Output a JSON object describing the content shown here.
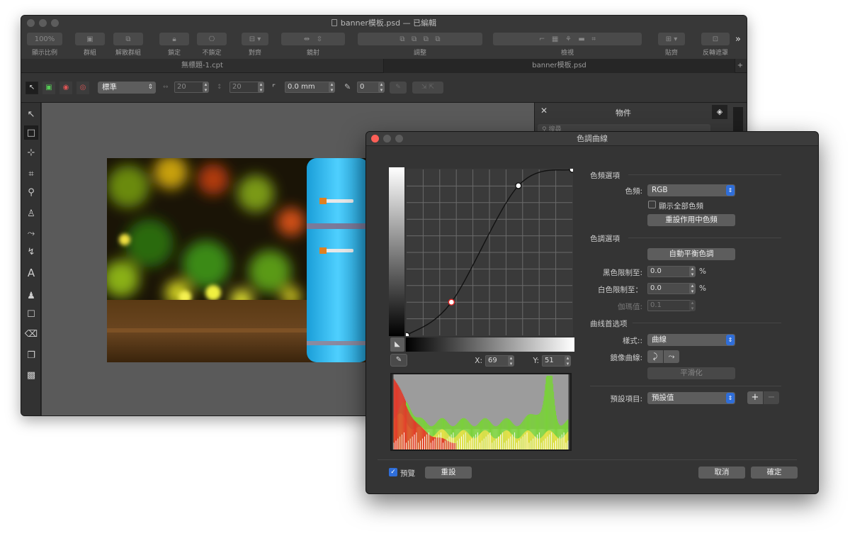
{
  "main_window": {
    "title": "banner模板.psd — 已編輯",
    "toolbar": [
      {
        "label": "顯示比例",
        "value": "100%"
      },
      {
        "label": "群組"
      },
      {
        "label": "解散群組"
      },
      {
        "label": "鎖定"
      },
      {
        "label": "不鎖定"
      },
      {
        "label": "對齊"
      },
      {
        "label": "鏡射"
      },
      {
        "label": "調整"
      },
      {
        "label": "檢視"
      },
      {
        "label": "貼齊"
      },
      {
        "label": "反轉遮罩"
      }
    ],
    "tabs": [
      "無標題-1.cpt",
      "banner模板.psd"
    ],
    "context_bar": {
      "style_select": "標準",
      "width_value": "20",
      "height_value": "20",
      "corner_value": "0.0 mm",
      "outline_value": "0"
    },
    "right_panel": {
      "title": "物件",
      "search_placeholder": "搜尋"
    }
  },
  "dialog": {
    "title": "色調曲線",
    "channel_section": "色頻選項",
    "channel_label": "色頻:",
    "channel_value": "RGB",
    "show_all_label": "顯示全部色頻",
    "reset_channel_button": "重設作用中色頻",
    "tone_section": "色調選項",
    "auto_balance_button": "自動平衡色調",
    "black_clip_label": "黑色限制至:",
    "black_clip_value": "0.0",
    "white_clip_label": "白色限制至：",
    "white_clip_value": "0.0",
    "percent": "%",
    "gamma_label": "伽瑪值:",
    "gamma_value": "0.1",
    "curve_section": "曲线首选项",
    "style_label": "樣式::",
    "style_value": "曲線",
    "mirror_label": "鏡像曲線:",
    "smooth_button": "平滑化",
    "preset_label": "預設項目:",
    "preset_value": "預設值",
    "x_label": "X:",
    "x_value": "69",
    "y_label": "Y:",
    "y_value": "51",
    "preview_label": "預覽",
    "reset_button": "重設",
    "cancel_button": "取消",
    "ok_button": "確定",
    "curve_points": [
      [
        0,
        0
      ],
      [
        69,
        51
      ],
      [
        172,
        230
      ],
      [
        255,
        255
      ]
    ]
  }
}
